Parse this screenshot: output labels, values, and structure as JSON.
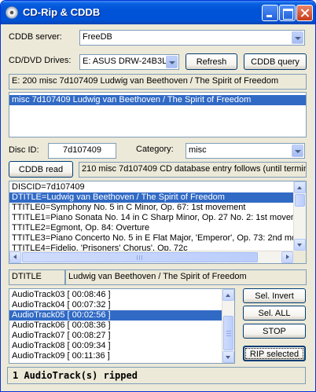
{
  "window": {
    "title": "CD-Rip & CDDB"
  },
  "server": {
    "label": "CDDB server:",
    "value": "FreeDB"
  },
  "drives": {
    "label": "CD/DVD Drives:",
    "value": "E: ASUS DRW-24B3L",
    "refresh_label": "Refresh",
    "query_label": "CDDB query"
  },
  "query_response": "E: 200 misc 7d107409 Ludwig van Beethoven / The Spirit of Freedom",
  "matches": [
    {
      "text": "misc 7d107409 Ludwig van Beethoven / The Spirit of Freedom",
      "selected": true
    }
  ],
  "disc": {
    "id_label": "Disc ID:",
    "id_value": "7d107409",
    "category_label": "Category:",
    "category_value": "misc"
  },
  "read": {
    "button_label": "CDDB read",
    "response": "210 misc 7d107409 CD database entry follows (until terminal"
  },
  "entry_lines": [
    {
      "text": "DISCID=7d107409",
      "selected": false
    },
    {
      "text": "DTITLE=Ludwig van Beethoven / The Spirit of Freedom",
      "selected": true
    },
    {
      "text": "TTITLE0=Symphony No. 5 in C Minor, Op. 67: 1st movement",
      "selected": false
    },
    {
      "text": "TTITLE1=Piano Sonata No. 14 in C Sharp Minor, Op. 27 No. 2: 1st moveme",
      "selected": false
    },
    {
      "text": "TTITLE2=Egmont, Op. 84: Overture",
      "selected": false
    },
    {
      "text": "TTITLE3=Piano Concerto No. 5 in E Flat Major, 'Emperor', Op. 73: 2nd mov",
      "selected": false
    },
    {
      "text": "TTITLE4=Fidelio, 'Prisoners' Chorus', Op. 72c",
      "selected": false
    }
  ],
  "edit": {
    "key": "DTITLE",
    "value": "Ludwig van Beethoven / The Spirit of Freedom"
  },
  "tracks": [
    {
      "text": "AudioTrack03 [ 00:08:46 ]",
      "selected": false
    },
    {
      "text": "AudioTrack04 [ 00:07:32 ]",
      "selected": false
    },
    {
      "text": "AudioTrack05 [ 00:02:56 ]",
      "selected": true
    },
    {
      "text": "AudioTrack06 [ 00:08:36 ]",
      "selected": false
    },
    {
      "text": "AudioTrack07 [ 00:08:27 ]",
      "selected": false
    },
    {
      "text": "AudioTrack08 [ 00:09:34 ]",
      "selected": false
    },
    {
      "text": "AudioTrack09 [ 00:11:36 ]",
      "selected": false
    }
  ],
  "actions": {
    "sel_invert": "Sel. Invert",
    "sel_all": "Sel. ALL",
    "stop": "STOP",
    "rip_selected": "RIP selected"
  },
  "status": "1 AudioTrack(s) ripped",
  "colors": {
    "titlebar": "#0053d8",
    "selection": "#316ac5",
    "dialog_bg": "#ece9d8"
  }
}
